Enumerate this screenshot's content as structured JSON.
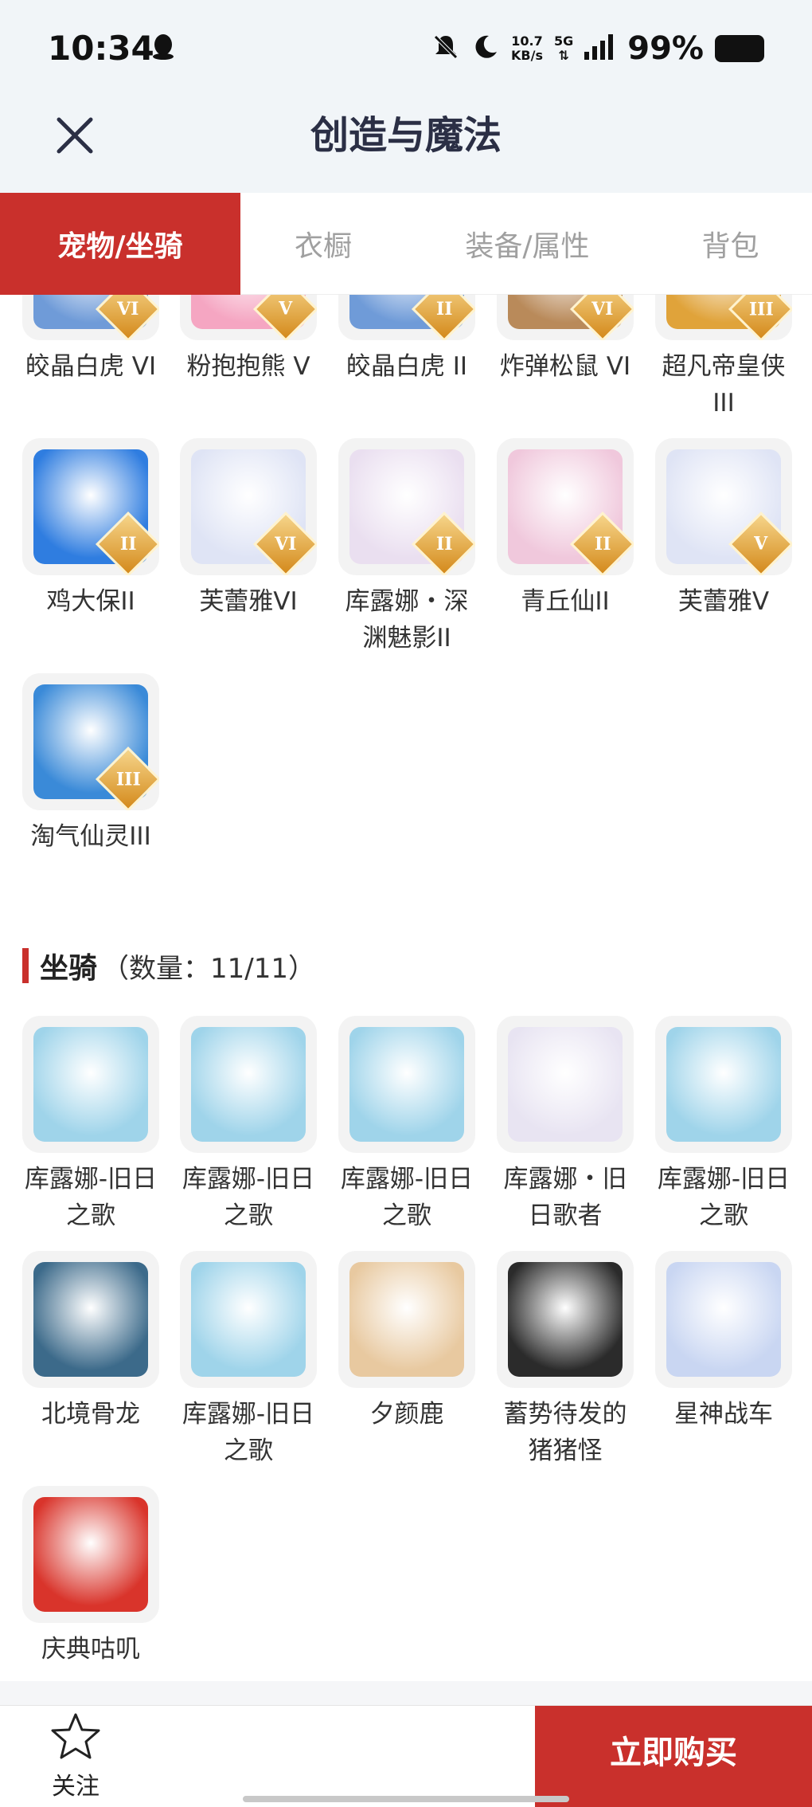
{
  "status_bar": {
    "time": "10:34",
    "net_speed_top": "10.7",
    "net_speed_bottom": "KB/s",
    "network": "5G",
    "battery": "99%"
  },
  "nav": {
    "title": "创造与魔法"
  },
  "tabs": [
    {
      "label": "宠物/坐骑",
      "active": true
    },
    {
      "label": "衣橱",
      "active": false
    },
    {
      "label": "装备/属性",
      "active": false
    },
    {
      "label": "背包",
      "active": false
    }
  ],
  "pets": [
    {
      "name": "皎晶白虎 VI",
      "badge": "VI",
      "color": "#6f9bd8",
      "icon": "white-tiger-icon"
    },
    {
      "name": "粉抱抱熊 V",
      "badge": "V",
      "color": "#f5a6c2",
      "icon": "pink-bear-icon"
    },
    {
      "name": "皎晶白虎 II",
      "badge": "II",
      "color": "#6f9bd8",
      "icon": "white-tiger-icon"
    },
    {
      "name": "炸弹松鼠 VI",
      "badge": "VI",
      "color": "#b98a5a",
      "icon": "squirrel-icon"
    },
    {
      "name": "超凡帝皇侠 III",
      "badge": "III",
      "color": "#e0a33a",
      "icon": "emperor-icon"
    },
    {
      "name": "鸡大保II",
      "badge": "II",
      "color": "#2f7de0",
      "icon": "chicken-icon"
    },
    {
      "name": "芙蕾雅VI",
      "badge": "VI",
      "color": "#dfe4f5",
      "icon": "freya-icon"
    },
    {
      "name": "库露娜・深渊魅影II",
      "badge": "II",
      "color": "#eadff0",
      "icon": "kuluna-icon"
    },
    {
      "name": "青丘仙II",
      "badge": "II",
      "color": "#f0c8dc",
      "icon": "fox-fairy-icon"
    },
    {
      "name": "芙蕾雅V",
      "badge": "V",
      "color": "#dfe4f5",
      "icon": "freya-icon"
    },
    {
      "name": "淘气仙灵III",
      "badge": "III",
      "color": "#3a8ad8",
      "icon": "blue-dog-icon"
    }
  ],
  "mounts_section": {
    "label": "坐骑",
    "count": "（数量：11/11）"
  },
  "mounts": [
    {
      "name": "库露娜-旧日之歌",
      "color": "#9fd4ea",
      "icon": "kuluna-mount-icon"
    },
    {
      "name": "库露娜-旧日之歌",
      "color": "#9fd4ea",
      "icon": "kuluna-mount-icon"
    },
    {
      "name": "库露娜-旧日之歌",
      "color": "#9fd4ea",
      "icon": "kuluna-mount-icon"
    },
    {
      "name": "库露娜・旧日歌者",
      "color": "#e8e4f2",
      "icon": "kuluna-singer-icon"
    },
    {
      "name": "库露娜-旧日之歌",
      "color": "#9fd4ea",
      "icon": "kuluna-mount-icon"
    },
    {
      "name": "北境骨龙",
      "color": "#3c6a8a",
      "icon": "bone-dragon-icon"
    },
    {
      "name": "库露娜-旧日之歌",
      "color": "#9fd4ea",
      "icon": "kuluna-mount-icon"
    },
    {
      "name": "夕颜鹿",
      "color": "#e8c9a0",
      "icon": "deer-icon"
    },
    {
      "name": "蓄势待发的猪猪怪",
      "color": "#2b2b2b",
      "icon": "pig-icon"
    },
    {
      "name": "星神战车",
      "color": "#c9d6f2",
      "icon": "star-chariot-icon"
    },
    {
      "name": "庆典咕叽",
      "color": "#d9342b",
      "icon": "celebration-gooji-icon"
    }
  ],
  "bottom_bar": {
    "follow_label": "关注",
    "buy_label": "立即购买"
  }
}
